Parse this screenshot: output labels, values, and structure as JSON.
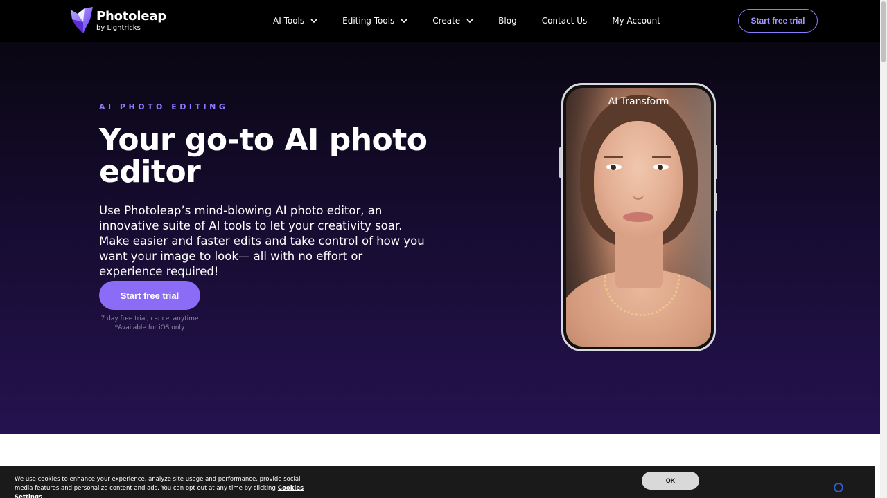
{
  "header": {
    "logo": {
      "name": "Photoleap",
      "by": "by Lightricks"
    },
    "nav": [
      {
        "label": "AI Tools",
        "has_dropdown": true
      },
      {
        "label": "Editing Tools",
        "has_dropdown": true
      },
      {
        "label": "Create",
        "has_dropdown": true
      },
      {
        "label": "Blog",
        "has_dropdown": false
      },
      {
        "label": "Contact Us",
        "has_dropdown": false
      },
      {
        "label": "My Account",
        "has_dropdown": false
      }
    ],
    "cta_label": "Start free trial"
  },
  "hero": {
    "eyebrow": "AI PHOTO EDITING",
    "headline": "Your go-to AI photo editor",
    "subcopy": "Use Photoleap’s mind-blowing AI photo editor, an innovative suite of AI tools to let your creativity soar. Make easier and faster edits and take control of how you want your image to look— all with no effort or experience required!",
    "cta_label": "Start free trial",
    "note_line1": "7 day free trial, cancel anytime",
    "note_line2": "*Available for iOS only",
    "phone_label": "AI Transform"
  },
  "cookie": {
    "text": "We use cookies to enhance your experience, analyze site usage and performance, provide social media features and personalize content and ads. You can opt out at any time by clicking",
    "link": "Cookies Settings",
    "ok_label": "OK"
  },
  "colors": {
    "accent": "#8b6cf6",
    "eyebrow": "#8d7cff",
    "header_bg": "#000000",
    "hero_bottom": "#24124f"
  },
  "icons": [
    "photoleap-logo-icon",
    "chevron-down-icon"
  ]
}
